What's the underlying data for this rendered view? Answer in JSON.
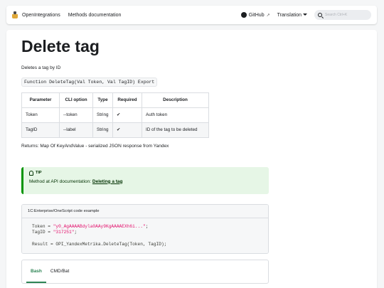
{
  "navbar": {
    "brand": "OpenIntegrations",
    "methods_link": "Methods documentation",
    "github_link": "GitHub",
    "translation_label": "Translation",
    "search_placeholder": "Search Ctrl+K"
  },
  "page": {
    "title": "Delete tag",
    "description": "Deletes a tag by ID",
    "signature": "Function DeleteTag(Val Token, Val TagID) Export",
    "returns": "Returns: Map Of KeyAndValue - serialized JSON response from Yandex"
  },
  "params_table": {
    "headers": [
      "Parameter",
      "CLI option",
      "Type",
      "Required",
      "Description"
    ],
    "rows": [
      [
        "Token",
        "--token",
        "String",
        "✔",
        "Auth token"
      ],
      [
        "TagID",
        "--label",
        "String",
        "✔",
        "ID of the tag to be deleted"
      ]
    ]
  },
  "tip": {
    "label": "TIP",
    "text": "Method at API documentation: ",
    "link": "Deleting a tag"
  },
  "code": {
    "title": "1C:Enterprise/OneScript code example",
    "line1_var": "Token",
    "line1_eq": " = ",
    "line1_val": "\"y0_AgAAAABdyla0AAy9KgAAAAEXh6i...\"",
    "line1_end": ";",
    "line2_var": "TagID",
    "line2_eq": " = ",
    "line2_val": "\"317251\"",
    "line2_end": ";",
    "line3": "Result = OPI_YandexMetrika.DeleteTag(Token, TagID);"
  },
  "tabs": [
    "Bash",
    "CMD/Bat"
  ],
  "colors": {
    "accent": "#2e8555",
    "tip_border": "#009400",
    "tip_bg": "#e6f6e6",
    "string": "#e3116c"
  }
}
